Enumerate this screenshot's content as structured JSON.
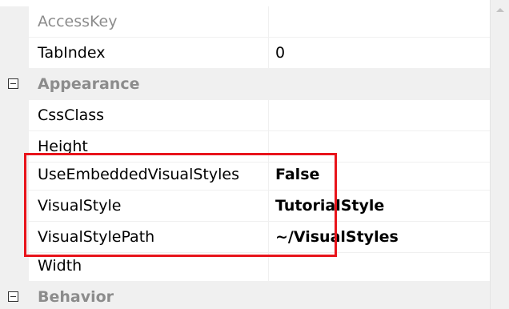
{
  "properties": {
    "access_key": {
      "name": "AccessKey",
      "value": ""
    },
    "tab_index": {
      "name": "TabIndex",
      "value": "0"
    },
    "appearance_category": {
      "label": "Appearance"
    },
    "css_class": {
      "name": "CssClass",
      "value": ""
    },
    "height": {
      "name": "Height",
      "value": ""
    },
    "use_embedded_visual_styles": {
      "name": "UseEmbeddedVisualStyles",
      "value": "False"
    },
    "visual_style": {
      "name": "VisualStyle",
      "value": "TutorialStyle"
    },
    "visual_style_path": {
      "name": "VisualStylePath",
      "value": "~/VisualStyles"
    },
    "width": {
      "name": "Width",
      "value": ""
    },
    "behavior_category": {
      "label": "Behavior"
    }
  },
  "highlight_color": "#e8141b",
  "icons": {
    "collapse": "minus-square-icon",
    "scroll_up": "triangle-up-icon"
  }
}
